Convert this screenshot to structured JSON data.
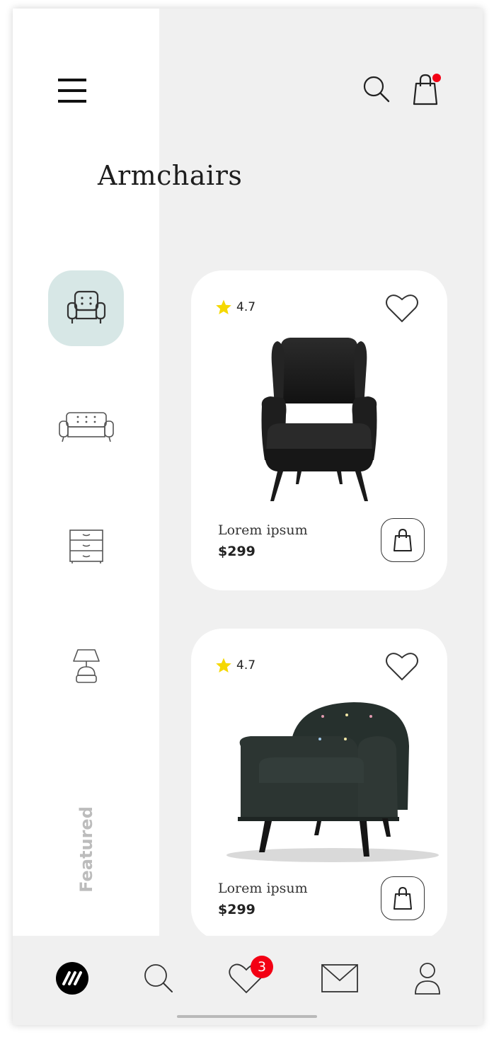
{
  "header": {
    "title": "Armchairs",
    "cart_dot_color": "#f30014"
  },
  "categories": [
    {
      "name": "armchair",
      "active": true
    },
    {
      "name": "sofa",
      "active": false
    },
    {
      "name": "drawer",
      "active": false
    },
    {
      "name": "lamp",
      "active": false
    }
  ],
  "sidebar": {
    "featured_label": "Featured"
  },
  "products": [
    {
      "rating": "4.7",
      "name": "Lorem ipsum",
      "price": "$299"
    },
    {
      "rating": "4.7",
      "name": "Lorem ipsum",
      "price": "$299"
    }
  ],
  "bottom_nav": {
    "favorites_badge": "3"
  },
  "colors": {
    "accent_active": "#d7e7e6",
    "star": "#f5d800",
    "badge": "#f30014"
  }
}
